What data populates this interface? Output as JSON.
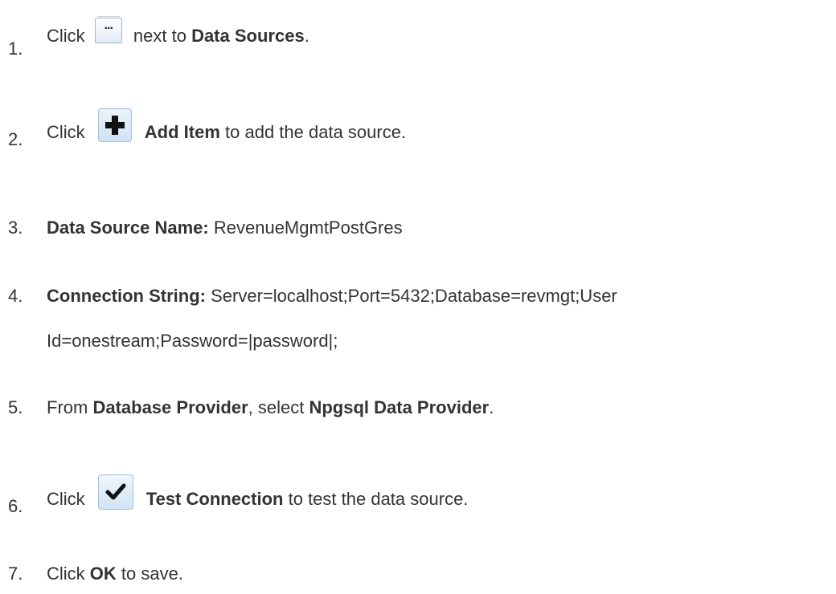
{
  "steps": [
    {
      "number": "1.",
      "before": "Click ",
      "icon": "ellipsis-icon",
      "after_plain": " next to ",
      "bold": "Data Sources",
      "end": "."
    },
    {
      "number": "2.",
      "before": "Click ",
      "icon": "plus-icon",
      "bold": "Add Item",
      "after": " to add the data source."
    },
    {
      "number": "3.",
      "bold": "Data Source Name:",
      "value": " RevenueMgmtPostGres"
    },
    {
      "number": "4.",
      "bold": "Connection String:",
      "value_line1": " Server=localhost;Port=5432;Database=revmgt;User",
      "value_line2": "Id=onestream;Password=|password|;"
    },
    {
      "number": "5.",
      "before": "From ",
      "bold1": "Database Provider",
      "middle": ", select ",
      "bold2": "Npgsql Data Provider",
      "end": "."
    },
    {
      "number": "6.",
      "before": "Click ",
      "icon": "checkmark-icon",
      "bold": "Test Connection",
      "after": " to test the data source."
    },
    {
      "number": "7.",
      "before": "Click ",
      "bold": "OK",
      "after": " to save."
    }
  ]
}
